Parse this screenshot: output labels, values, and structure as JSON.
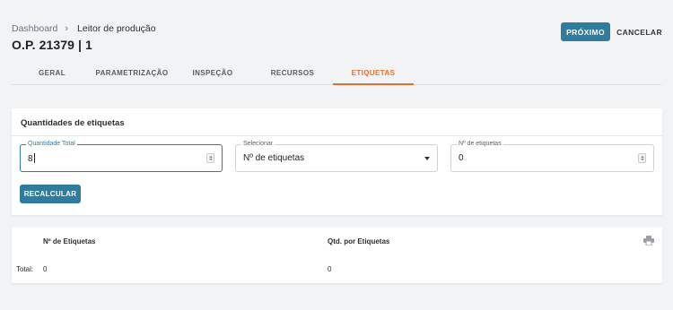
{
  "breadcrumb": {
    "root": "Dashboard",
    "separator": "›",
    "current": "Leitor de produção"
  },
  "page_title": "O.P. 21379 | 1",
  "actions": {
    "next_label": "PRÓXIMO",
    "cancel_label": "CANCELAR"
  },
  "tabs": [
    {
      "label": "GERAL",
      "active": false
    },
    {
      "label": "PARAMETRIZAÇÃO",
      "active": false
    },
    {
      "label": "INSPEÇÃO",
      "active": false
    },
    {
      "label": "RECURSOS",
      "active": false
    },
    {
      "label": "ETIQUETAS",
      "active": true
    }
  ],
  "quantities_card": {
    "title": "Quantidades de etiquetas",
    "total_quantity": {
      "label": "Quantidade Total",
      "value": "8"
    },
    "select": {
      "label": "Selecionar",
      "value": "Nº de etiquetas"
    },
    "label_count": {
      "label": "Nº de etiquetas",
      "value": "0"
    },
    "recalc_label": "RECALCULAR"
  },
  "summary_table": {
    "headers": [
      "Nº de Etiquetas",
      "Qtd. por Etiquetas"
    ],
    "total_label": "Total:",
    "totals": [
      "0",
      "0"
    ]
  },
  "colors": {
    "primary": "#2f7c9f",
    "active_tab": "#e4702f",
    "background": "#f2f3f5"
  },
  "icons": {
    "print": "printer-icon",
    "breadcrumb_separator": "chevron-right-icon",
    "select_arrow": "caret-down-icon"
  }
}
